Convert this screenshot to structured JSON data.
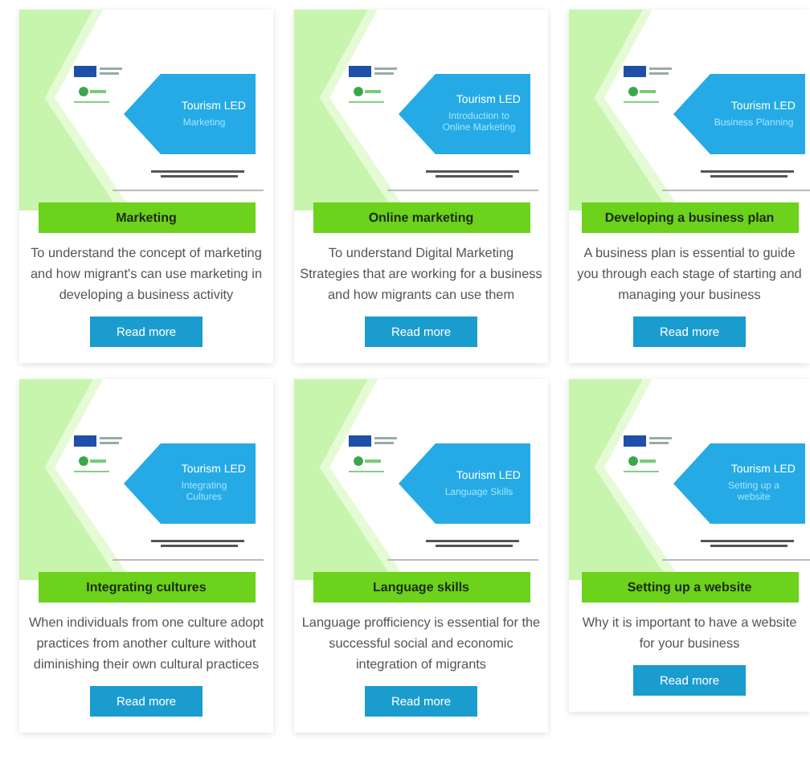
{
  "cards": [
    {
      "slide": {
        "heading": "Tourism LED",
        "subtitle": "Marketing"
      },
      "title": "Marketing",
      "description": "To understand the concept of marketing and how migrant's can use marketing in developing a business activity",
      "button": "Read more"
    },
    {
      "slide": {
        "heading": "Tourism LED",
        "subtitle": "Introduction to Online Marketing"
      },
      "title": "Online marketing",
      "description": "To understand Digital Marketing Strategies that are working for a business and how migrants can use them",
      "button": "Read more"
    },
    {
      "slide": {
        "heading": "Tourism LED",
        "subtitle": "Business Planning"
      },
      "title": "Developing a business plan",
      "description": "A business plan is essential to guide you through each stage of starting and managing your business",
      "button": "Read more"
    },
    {
      "slide": {
        "heading": "Tourism LED",
        "subtitle": "Integrating Cultures"
      },
      "title": "Integrating cultures",
      "description": "When individuals from one culture adopt practices from another culture without diminishing their own cultural practices",
      "button": "Read more"
    },
    {
      "slide": {
        "heading": "Tourism LED",
        "subtitle": "Language Skills"
      },
      "title": "Language skills",
      "description": "Language profficiency is essential for the successful social and economic integration of migrants",
      "button": "Read more"
    },
    {
      "slide": {
        "heading": "Tourism LED",
        "subtitle": "Setting up a website"
      },
      "title": "Setting up a website",
      "description": "Why it is important to have a website for your business",
      "button": "Read more"
    }
  ]
}
